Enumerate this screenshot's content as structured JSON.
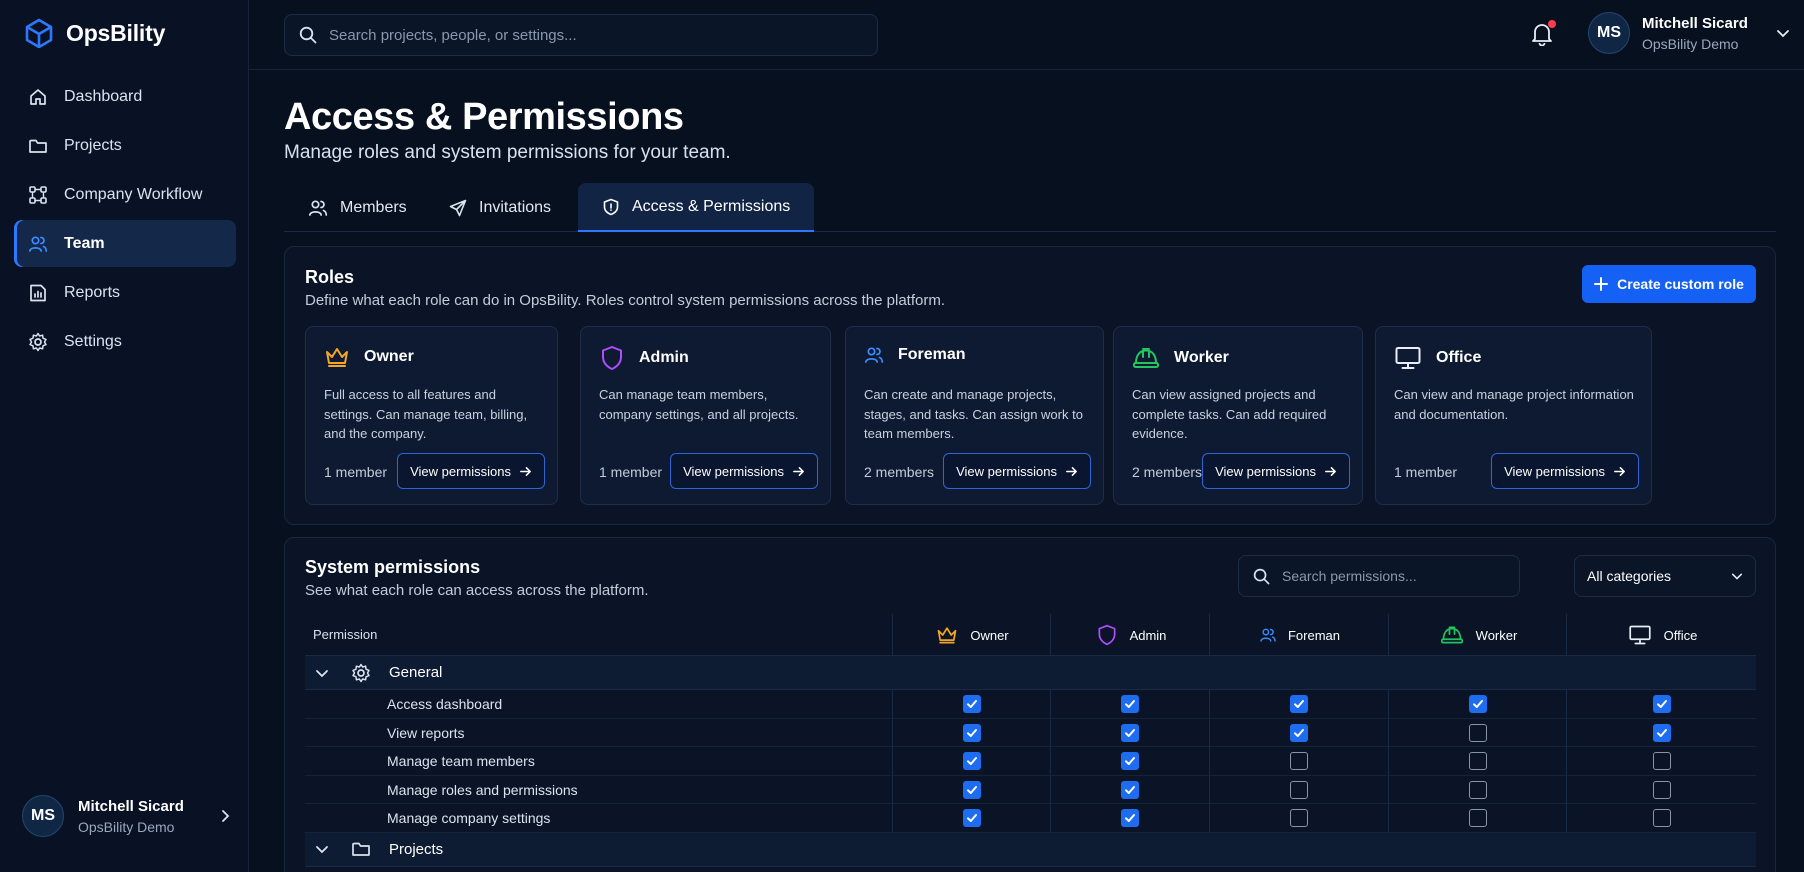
{
  "brand": {
    "name": "OpsBility",
    "accent": "#2e78ff"
  },
  "nav": [
    {
      "label": "Dashboard",
      "icon": "home-icon"
    },
    {
      "label": "Projects",
      "icon": "folder-icon"
    },
    {
      "label": "Company Workflow",
      "icon": "workflow-icon"
    },
    {
      "label": "Team",
      "icon": "team-icon",
      "active": true
    },
    {
      "label": "Reports",
      "icon": "reports-icon"
    },
    {
      "label": "Settings",
      "icon": "gear-icon"
    }
  ],
  "user": {
    "initials": "MS",
    "name": "Mitchell Sicard",
    "org": "OpsBility Demo"
  },
  "search": {
    "placeholder": "Search projects, people, or settings..."
  },
  "page": {
    "title": "Access & Permissions",
    "subtitle": "Manage roles and system permissions for your team."
  },
  "tabs": [
    {
      "label": "Members",
      "icon": "users-icon"
    },
    {
      "label": "Invitations",
      "icon": "send-icon"
    },
    {
      "label": "Access & Permissions",
      "icon": "shield-icon",
      "active": true
    }
  ],
  "roles_section": {
    "title": "Roles",
    "subtitle": "Define what each role can do in OpsBility. Roles control system permissions across the platform.",
    "create_label": "Create custom role",
    "view_label": "View permissions",
    "roles": [
      {
        "name": "Owner",
        "icon": "crown-icon",
        "color": "#f5a623",
        "desc": "Full access to all features and settings. Can manage team, billing, and the company.",
        "count": "1 member"
      },
      {
        "name": "Admin",
        "icon": "shield-icon",
        "color": "#b14cff",
        "desc": "Can manage team members, company settings, and all projects.",
        "count": "1 member"
      },
      {
        "name": "Foreman",
        "icon": "users-icon",
        "color": "#3d8bff",
        "desc": "Can create and manage projects, stages, and tasks. Can assign work to team members.",
        "count": "2 members"
      },
      {
        "name": "Worker",
        "icon": "hardhat-icon",
        "color": "#22c55e",
        "desc": "Can view assigned projects and complete tasks. Can add required evidence.",
        "count": "2 members"
      },
      {
        "name": "Office",
        "icon": "monitor-icon",
        "color": "#e8eef8",
        "desc": "Can view and manage project information and documentation.",
        "count": "1 member"
      }
    ]
  },
  "permissions_section": {
    "title": "System permissions",
    "subtitle": "See what each role can access across the platform.",
    "search_placeholder": "Search permissions...",
    "category_label": "All categories",
    "col_permission": "Permission",
    "groups": [
      {
        "name": "General",
        "icon": "gear-icon",
        "rows": [
          {
            "label": "Access dashboard",
            "values": [
              true,
              true,
              true,
              true,
              true
            ]
          },
          {
            "label": "View reports",
            "values": [
              true,
              true,
              true,
              false,
              true
            ]
          },
          {
            "label": "Manage team members",
            "values": [
              true,
              true,
              false,
              false,
              false
            ]
          },
          {
            "label": "Manage roles and permissions",
            "values": [
              true,
              true,
              false,
              false,
              false
            ]
          },
          {
            "label": "Manage company settings",
            "values": [
              true,
              true,
              false,
              false,
              false
            ]
          }
        ]
      },
      {
        "name": "Projects",
        "icon": "folder-icon",
        "rows": []
      }
    ]
  }
}
